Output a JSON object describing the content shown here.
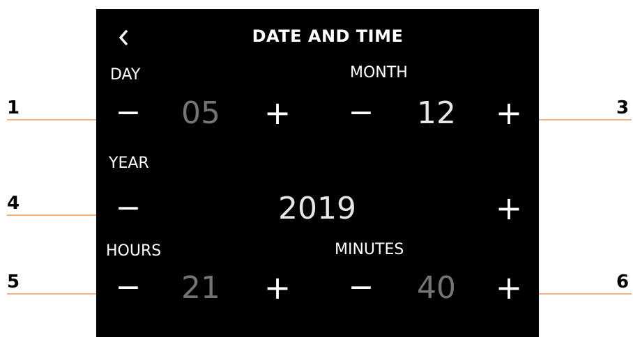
{
  "header": {
    "back_icon": "chevron-left-icon",
    "title": "DATE AND TIME"
  },
  "day": {
    "label": "DAY",
    "value": "05",
    "decrement": "−",
    "increment": "+"
  },
  "month": {
    "label": "MONTH",
    "value": "12",
    "decrement": "−",
    "increment": "+"
  },
  "year": {
    "label": "YEAR",
    "value": "2019",
    "decrement": "−",
    "increment": "+"
  },
  "hours": {
    "label": "HOURS",
    "value": "21",
    "decrement": "−",
    "increment": "+"
  },
  "minutes": {
    "label": "MINUTES",
    "value": "40",
    "decrement": "−",
    "increment": "+"
  },
  "callouts": {
    "c1": "1",
    "c3": "3",
    "c4": "4",
    "c5": "5",
    "c6": "6",
    "line_color": "#f2b27f"
  },
  "colors": {
    "screen_bg": "#000000",
    "text_primary": "#ffffff",
    "value_dim": "#747474",
    "value_bright": "#e6e6e6"
  }
}
